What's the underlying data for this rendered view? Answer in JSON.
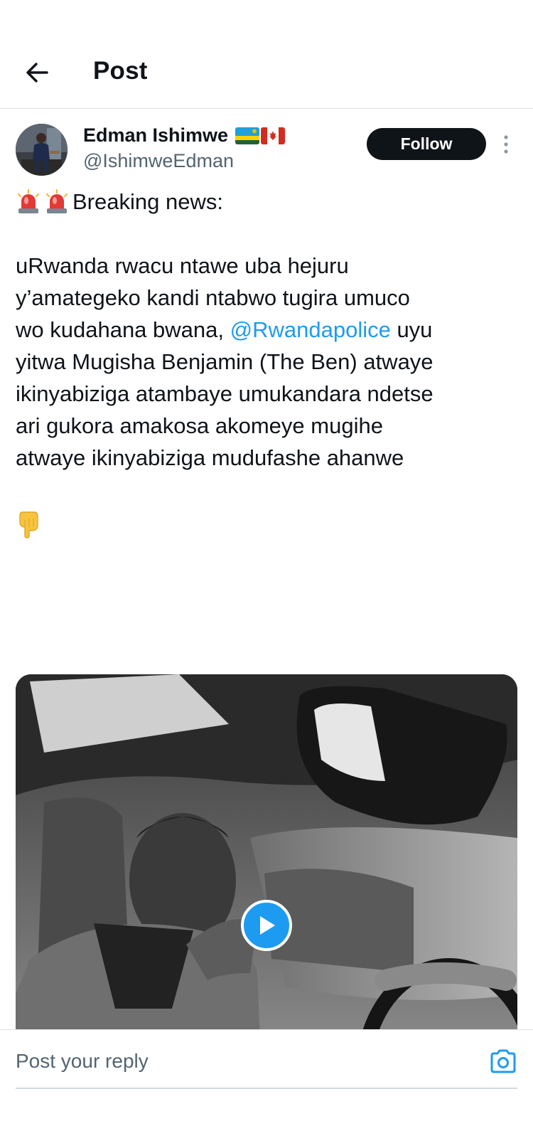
{
  "header": {
    "title": "Post",
    "back_icon": "arrow-left-icon"
  },
  "post": {
    "author": {
      "name": "Edman Ishimwe",
      "flags": [
        "rwanda-flag",
        "canada-flag"
      ],
      "handle": "@IshimweEdman"
    },
    "follow_label": "Follow",
    "more_icon": "more-vertical-icon",
    "headline": "Breaking news:",
    "headline_icons": [
      "siren-icon",
      "siren-icon"
    ],
    "body": {
      "line1": "uRwanda rwacu ntawe uba hejuru",
      "line2": "y’amategeko kandi ntabwo tugira umuco",
      "line3_pre": "wo kudahana bwana, ",
      "mention": "@Rwandapolice",
      "line3_post": " uyu",
      "line4": "yitwa Mugisha Benjamin (The Ben) atwaye",
      "line5": "ikinyabiziga atambaye umukandara ndetse",
      "line6": "ari gukora amakosa akomeye mugihe",
      "line7": "atwaye ikinyabiziga mudufashe ahanwe"
    },
    "trailing_icon": "pointing-down-icon",
    "media": {
      "type": "video",
      "play_icon": "play-icon"
    }
  },
  "reply": {
    "placeholder": "Post your reply",
    "camera_icon": "camera-icon"
  },
  "colors": {
    "accent": "#1d9bf0",
    "text": "#0f1419",
    "secondary": "#536471",
    "border": "#dfe3e6"
  }
}
